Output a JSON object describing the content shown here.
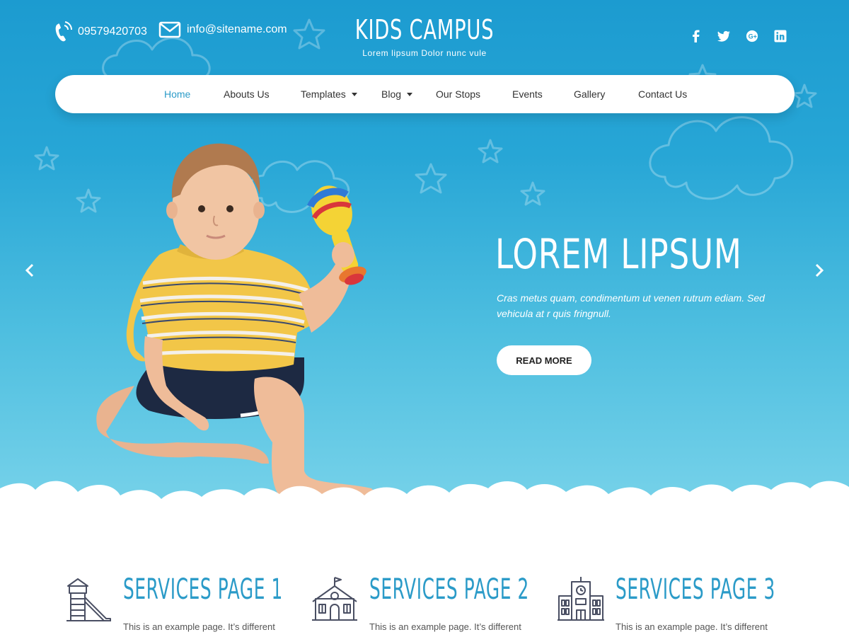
{
  "header": {
    "phone": "09579420703",
    "email": "info@sitename.com",
    "brand_name": "KIDS CAMPUS",
    "brand_tagline": "Lorem lipsum Dolor nunc vule",
    "social": [
      "facebook-icon",
      "twitter-icon",
      "google-plus-icon",
      "linkedin-icon"
    ]
  },
  "nav": {
    "items": [
      {
        "label": "Home",
        "active": true
      },
      {
        "label": "Abouts Us"
      },
      {
        "label": "Templates",
        "dropdown": true
      },
      {
        "label": "Blog",
        "dropdown": true
      },
      {
        "label": "Our Stops"
      },
      {
        "label": "Events"
      },
      {
        "label": "Gallery"
      },
      {
        "label": "Contact Us"
      }
    ]
  },
  "slide": {
    "title": "LOREM LIPSUM",
    "text": "Cras metus quam, condimentum ut venen rutrum ediam. Sed vehicula at r quis fringnull.",
    "button": "READ MORE"
  },
  "services": [
    {
      "title": "SERVICES PAGE 1",
      "desc": "This is an example page. It’s different",
      "icon": "playground-slide-icon"
    },
    {
      "title": "SERVICES PAGE 2",
      "desc": "This is an example page. It’s different",
      "icon": "school-house-icon"
    },
    {
      "title": "SERVICES PAGE 3",
      "desc": "This is an example page. It’s different",
      "icon": "school-building-icon"
    }
  ],
  "colors": {
    "hero_top": "#1c9bd0",
    "hero_bottom": "#79d3ea",
    "accent": "#2b9bc8",
    "icon_stroke": "#4a4f63"
  }
}
